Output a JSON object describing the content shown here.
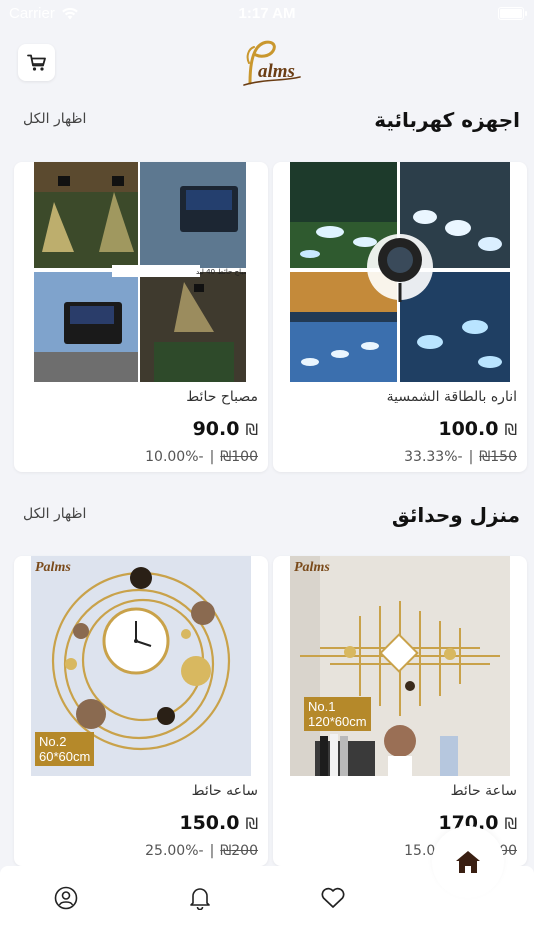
{
  "status_bar": {
    "carrier": "Carrier",
    "time": "1:17 AM"
  },
  "header": {
    "logo_text": "Palms",
    "cart_icon": "shopping-cart-icon"
  },
  "sections": [
    {
      "title": "اجهزه كهربائية",
      "show_all": "اظهار الكل",
      "products": [
        {
          "name": "اناره بالطاقة الشمسية",
          "price": "100.0",
          "currency": "₪",
          "old_price": "150",
          "discount": "33.33%-"
        },
        {
          "name": "مصباح حائط",
          "price": "90.0",
          "currency": "₪",
          "old_price": "100",
          "discount": "10.00%-",
          "image_caption": "مصباح حائط 40 ليد"
        }
      ]
    },
    {
      "title": "منزل وحدائق",
      "show_all": "اظهار الكل",
      "products": [
        {
          "name": "ساعة حائط",
          "price": "170.0",
          "currency": "₪",
          "old_price": "200",
          "discount": "15.00%-",
          "image_tag_line1": "No.1",
          "image_tag_line2": "120*60cm",
          "image_logo": "Palms"
        },
        {
          "name": "ساعه حائط",
          "price": "150.0",
          "currency": "₪",
          "old_price": "200",
          "discount": "25.00%-",
          "image_tag_line1": "No.2",
          "image_tag_line2": "60*60cm",
          "image_logo": "Palms"
        }
      ]
    }
  ],
  "bottom_nav": {
    "items": [
      "profile-icon",
      "bell-icon",
      "heart-icon",
      "home-icon"
    ],
    "active": "home-icon"
  },
  "colors": {
    "background": "#f3f4f8",
    "brand": "#b5892a",
    "text": "#111111"
  }
}
